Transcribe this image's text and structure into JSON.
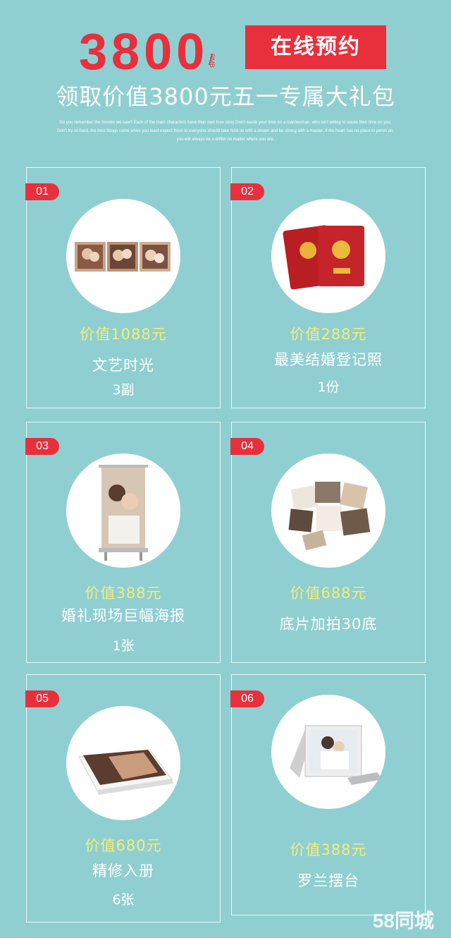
{
  "header": {
    "price": "3800",
    "slash": "/",
    "rmb": "RMB",
    "book_button": "在线预约",
    "subtitle": "领取价值3800元五一专属大礼包",
    "english_text": "Do you remember the movies we saw? Each of the main characters have their own love story Don't waste your time on a man/woman, who isn't willing to waste their time on you. Don't try so hard, the best things come when you least expect them to everyone should take hold on with a dream and be strong with a master. If the heart has no place to perch on, you will always be a drifter no matter where you are."
  },
  "cards": [
    {
      "num": "01",
      "price": "价值1088元",
      "name": "文艺时光",
      "qty": "3副",
      "image": "couple-photos-strip"
    },
    {
      "num": "02",
      "price": "价值288元",
      "name": "最美结婚登记照",
      "qty": "1份",
      "image": "marriage-certificates"
    },
    {
      "num": "03",
      "price": "价值388元",
      "name": "婚礼现场巨幅海报",
      "qty": "1张",
      "image": "rollup-poster"
    },
    {
      "num": "04",
      "price": "价值688元",
      "name": "底片加拍30底",
      "qty": "",
      "image": "scattered-photos"
    },
    {
      "num": "05",
      "price": "价值680元",
      "name": "精修入册",
      "qty": "6张",
      "image": "photo-album"
    },
    {
      "num": "06",
      "price": "价值388元",
      "name": "罗兰摆台",
      "qty": "",
      "image": "photo-frame-stand"
    }
  ],
  "watermark": "58同城",
  "colors": {
    "background": "#8fcfd2",
    "accent": "#e8303c",
    "price": "#f3ed7a"
  }
}
